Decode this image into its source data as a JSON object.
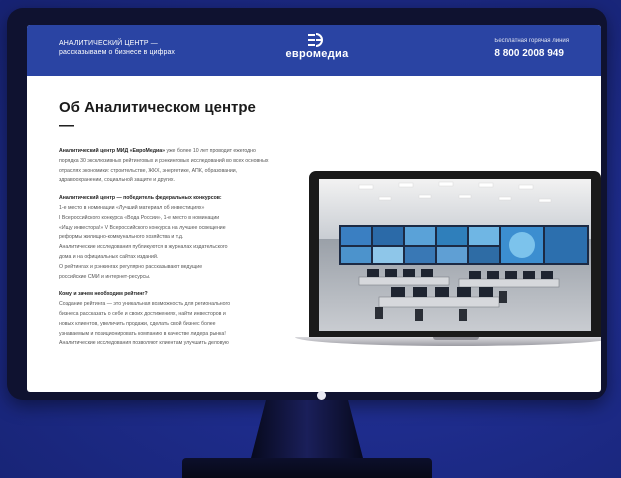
{
  "header": {
    "brand_line1": "АНАЛИТИЧЕСКИЙ ЦЕНТР —",
    "brand_line2": "рассказываем о бизнесе в цифрах",
    "logo_text": "евромедиа",
    "hotline_label": "Бесплатная горячая линия",
    "hotline_phone": "8 800 2008 949",
    "background": "#2a44a3"
  },
  "main": {
    "title": "Об Аналитическом центре —",
    "p1_bold": "Аналитический центр МИД «ЕвроМедиа»",
    "p1_rest": "уже более 10 лет проводит ежегодно порядка 30 эксклюзивных рейтинговых и рэнкинговых исследований во всех основных отраслях экономики: строительстве, ЖКХ, энергетике, АПК, образовании, здравоохранении, социальной защите и других.",
    "p2_bold": "Аналитический центр — победитель федеральных конкурсов:",
    "p2_lines": [
      "1-е место в номинации «Лучший материал об инвестициях»",
      "I Всероссийского конкурса «Вода России», 1-е место в номинации",
      "«Ищу инвестора!» V Всероссийского конкурса на лучшее освещение",
      "реформы жилищно-коммунального хозяйства и т.д.",
      "Аналитические исследования публикуются в журналах издательского",
      "дома и на официальных сайтах изданий.",
      "О рейтингах и рэнкингах регулярно рассказывают ведущие",
      "российские СМИ и интернет-ресурсы."
    ],
    "p3_bold": "Кому и зачем необходим рейтинг?",
    "p3_lines": [
      "Создание рейтинга — это уникальная возможность для регионального",
      "бизнеса рассказать о себе и своих достижениях, найти инвесторов и",
      "новых клиентов, увеличить продажи, сделать свой бизнес более",
      "узнаваемым и позиционировать компанию в качестве лидера рынка!",
      "Аналитические исследования позволяют клиентам улучшить деловую"
    ]
  },
  "icons": {
    "logo": "euromedia-logo-icon",
    "laptop_image": "control-room-photo"
  },
  "colors": {
    "accent": "#2a44a3",
    "background": "#1e2c8c"
  }
}
